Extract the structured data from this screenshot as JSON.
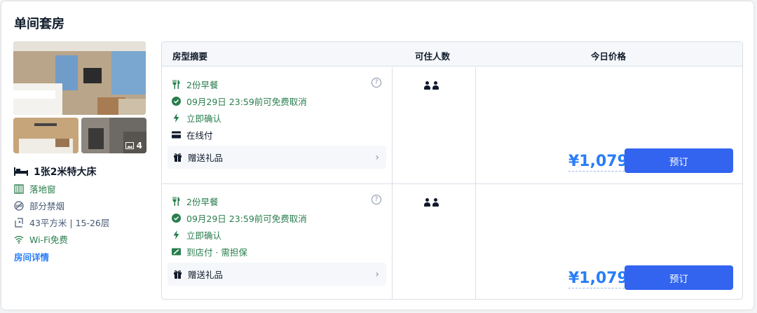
{
  "room": {
    "title": "单间套房",
    "photo_count": "4",
    "bed": "1张2米特大床",
    "features": [
      {
        "icon": "window-icon",
        "text": "落地窗",
        "color": "#287d4c"
      },
      {
        "icon": "no-smoking-icon",
        "text": "部分禁烟",
        "color": "#455873"
      },
      {
        "icon": "area-icon",
        "text": "43平方米 | 15-26层",
        "color": "#455873"
      },
      {
        "icon": "wifi-icon",
        "text": "Wi-Fi免费",
        "color": "#287d4c"
      }
    ],
    "details_link": "房间详情"
  },
  "table": {
    "headers": {
      "summary": "房型摘要",
      "guests": "可住人数",
      "price": "今日价格"
    },
    "rows": [
      {
        "breakfast": "2份早餐",
        "cancel": "09月29日 23:59前可免费取消",
        "confirm": "立即确认",
        "payment": "在线付",
        "gift": "赠送礼品",
        "price": "¥1,079",
        "book": "预订"
      },
      {
        "breakfast": "2份早餐",
        "cancel": "09月29日 23:59前可免费取消",
        "confirm": "立即确认",
        "payment": "到店付 · 需担保",
        "gift": "赠送礼品",
        "price": "¥1,079",
        "book": "预订"
      }
    ]
  },
  "colors": {
    "accent": "#287dfa",
    "button": "#3264f0",
    "green": "#287d4c"
  }
}
